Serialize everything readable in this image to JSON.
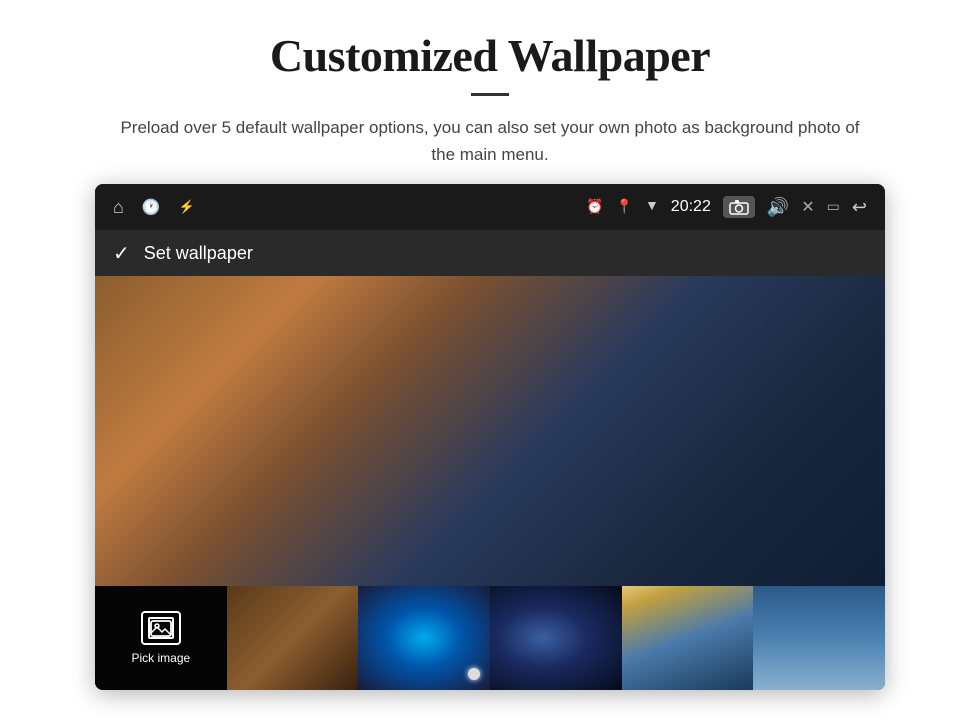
{
  "header": {
    "title": "Customized Wallpaper",
    "subtitle": "Preload over 5 default wallpaper options, you can also set your own photo as background photo of the main menu.",
    "divider_visible": true
  },
  "device": {
    "status_bar": {
      "time": "20:22",
      "left_icons": [
        "home",
        "clock",
        "usb"
      ],
      "right_icons": [
        "alarm",
        "location",
        "wifi",
        "camera",
        "volume",
        "close",
        "window",
        "back"
      ]
    },
    "wallpaper_bar": {
      "label": "Set wallpaper"
    },
    "thumbnails": [
      {
        "id": "pick",
        "label": "Pick image"
      },
      {
        "id": "thumb2",
        "label": ""
      },
      {
        "id": "thumb3",
        "label": ""
      },
      {
        "id": "thumb4",
        "label": ""
      },
      {
        "id": "thumb5",
        "label": ""
      },
      {
        "id": "thumb6",
        "label": ""
      }
    ]
  }
}
